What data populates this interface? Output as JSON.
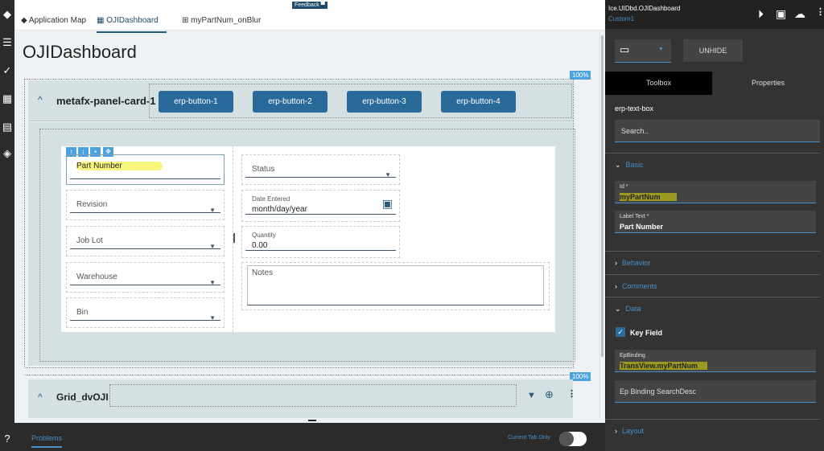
{
  "left_sidebar": {
    "icons": [
      "layers-icon",
      "list-icon",
      "checklist-icon",
      "sitemap-icon",
      "calendar-grid-icon",
      "tag-icon",
      "help-icon"
    ]
  },
  "tabs": [
    {
      "label": "Application Map",
      "icon": "layers-icon"
    },
    {
      "label": "OJIDashboard",
      "icon": "dashboard-icon",
      "active": true
    },
    {
      "label": "myPartNum_onBlur",
      "icon": "sitemap-icon"
    }
  ],
  "feedback_label": "Feedback",
  "page_title": "OJIDashboard",
  "zoom_badge": "100%",
  "panel_card": {
    "title": "metafx-panel-card-1",
    "buttons": [
      "erp-button-1",
      "erp-button-2",
      "erp-button-3",
      "erp-button-4"
    ]
  },
  "form": {
    "part_number": {
      "label": "Part Number"
    },
    "revision": {
      "label": "Revision"
    },
    "job_lot": {
      "label": "Job Lot"
    },
    "warehouse": {
      "label": "Warehouse"
    },
    "bin": {
      "label": "Bin"
    },
    "status": {
      "label": "Status"
    },
    "date_entered": {
      "label": "Date Entered",
      "value": "month/day/year"
    },
    "quantity": {
      "label": "Quantity",
      "value": "0.00"
    },
    "notes": {
      "label": "Notes"
    }
  },
  "grid_card": {
    "title": "Grid_dvOJI",
    "zoom_badge": "100%"
  },
  "bottom": {
    "problems_tab": "Problems",
    "current_tab_only": "Current Tab Only",
    "toggle_on": false
  },
  "right_panel": {
    "title": "Ice.UIDbd.OJIDashboard",
    "subtitle": "Custom1",
    "unhide_label": "UNHIDE",
    "tabs": [
      "Toolbox",
      "Properties"
    ],
    "component_name": "erp-text-box",
    "search_placeholder": "Search..",
    "sections": {
      "basic": "Basic",
      "behavior": "Behavior",
      "comments": "Comments",
      "data": "Data",
      "layout": "Layout"
    },
    "id": {
      "label": "Id *",
      "value": "myPartNum"
    },
    "label_text": {
      "label": "Label Text *",
      "value": "Part Number"
    },
    "key_field": {
      "label": "Key Field",
      "checked": true
    },
    "ep_binding": {
      "label": "EpBinding",
      "value": "TransView.myPartNum"
    },
    "ep_binding_search_desc": {
      "placeholder": "Ep Binding SearchDesc"
    }
  },
  "colors": {
    "accent": "#2a6a9a",
    "highlight": "#f0f000",
    "panel_dark": "#333333"
  }
}
